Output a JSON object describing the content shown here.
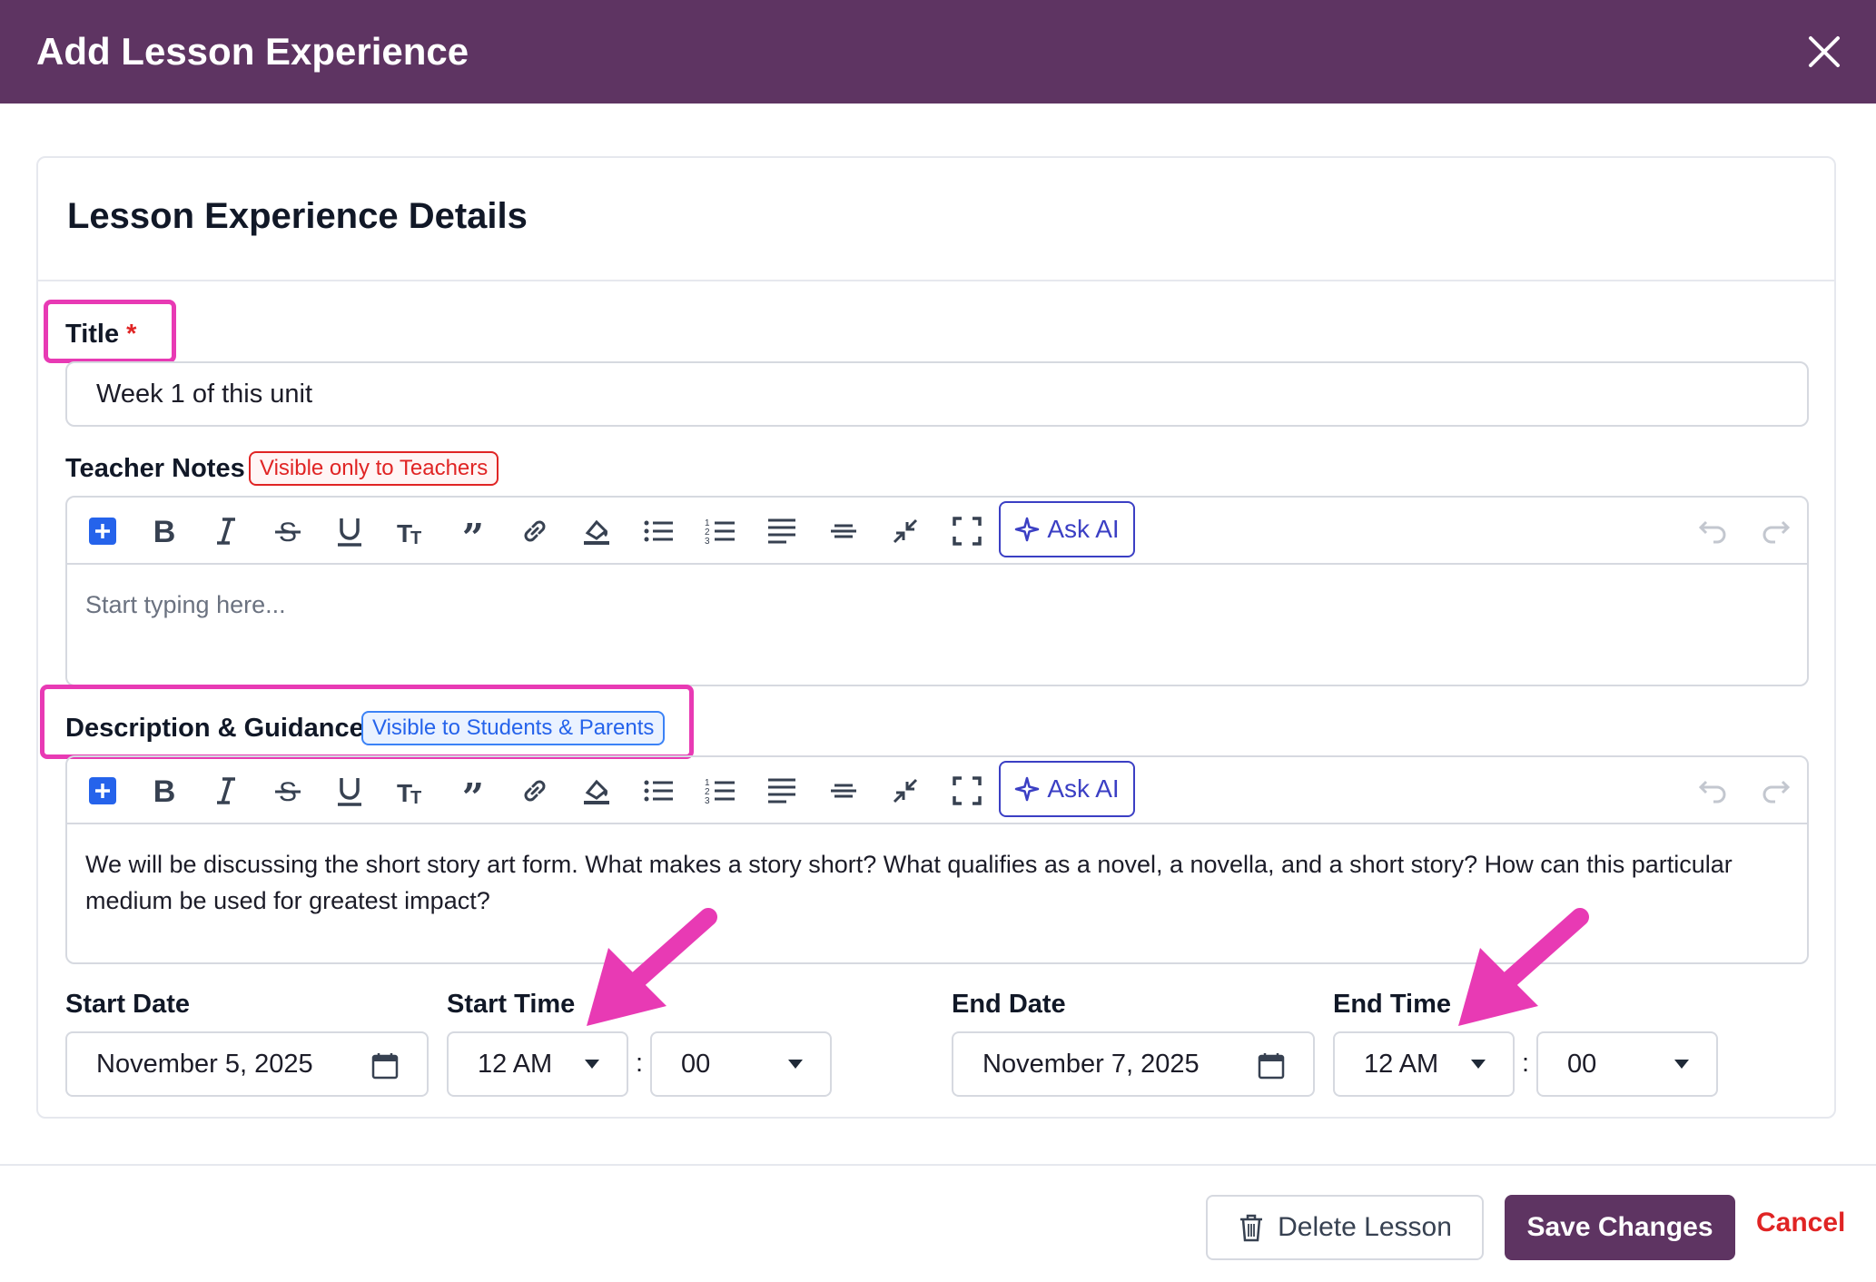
{
  "dialog": {
    "title": "Add Lesson Experience"
  },
  "details": {
    "heading": "Lesson Experience Details"
  },
  "title_field": {
    "label": "Title",
    "required_mark": "*",
    "value": "Week 1 of this unit"
  },
  "teacher_notes": {
    "label": "Teacher Notes",
    "badge": "Visible only to Teachers",
    "ask_ai": "Ask AI",
    "placeholder": "Start typing here..."
  },
  "description": {
    "label": "Description & Guidance",
    "badge": "Visible to Students & Parents",
    "ask_ai": "Ask AI",
    "text": "We will be discussing the short story art form. What makes a story short? What qualifies as a novel, a novella, and a short story? How can this particular medium be used for greatest impact?"
  },
  "toolbar_icons": [
    "plus-icon",
    "bold-icon",
    "italic-icon",
    "strikethrough-icon",
    "underline-icon",
    "font-size-icon",
    "quote-icon",
    "link-icon",
    "highlight-icon",
    "bulleted-list-icon",
    "numbered-list-icon",
    "align-icon",
    "horizontal-rule-icon",
    "collapse-icon",
    "fullscreen-icon",
    "sparkle-icon",
    "undo-icon",
    "redo-icon"
  ],
  "schedule": {
    "start_date_label": "Start Date",
    "start_date": "November 5, 2025",
    "start_time_label": "Start Time",
    "start_hour": "12 AM",
    "start_minute": "00",
    "end_date_label": "End Date",
    "end_date": "November 7, 2025",
    "end_time_label": "End Time",
    "end_hour": "12 AM",
    "end_minute": "00",
    "separator": ":"
  },
  "footer": {
    "delete_label": "Delete Lesson",
    "save_label": "Save Changes",
    "cancel_label": "Cancel"
  },
  "colors": {
    "header": "#5e3462",
    "highlight": "#e83ab4",
    "danger": "#e02424",
    "link_blue": "#2563eb",
    "ai": "#3b3fc4"
  }
}
